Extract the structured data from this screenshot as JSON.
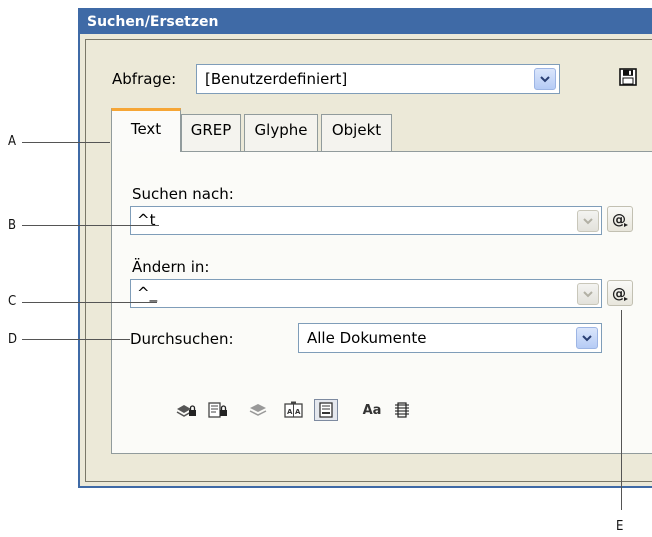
{
  "window": {
    "title": "Suchen/Ersetzen"
  },
  "query": {
    "label": "Abfrage:",
    "value": "[Benutzerdefiniert]"
  },
  "tabs": [
    {
      "label": "Text",
      "active": true
    },
    {
      "label": "GREP",
      "active": false
    },
    {
      "label": "Glyphe",
      "active": false
    },
    {
      "label": "Objekt",
      "active": false
    }
  ],
  "find": {
    "label": "Suchen nach:",
    "value": "^t"
  },
  "change": {
    "label": "Ändern in:",
    "value": "^_"
  },
  "search": {
    "label": "Durchsuchen:",
    "value": "Alle Dokumente"
  },
  "callouts": {
    "a": "A",
    "b": "B",
    "c": "C",
    "d": "D",
    "e": "E"
  },
  "colors": {
    "titlebar": "#3f6aa6",
    "active_tab_accent": "#f6a636",
    "dialog_bg": "#ece9d8"
  },
  "icons": [
    "include-locked-layers-icon",
    "include-locked-stories-icon",
    "include-hidden-layers-icon",
    "include-master-pages-icon",
    "include-footnotes-icon",
    "case-sensitive-icon",
    "whole-word-icon"
  ]
}
